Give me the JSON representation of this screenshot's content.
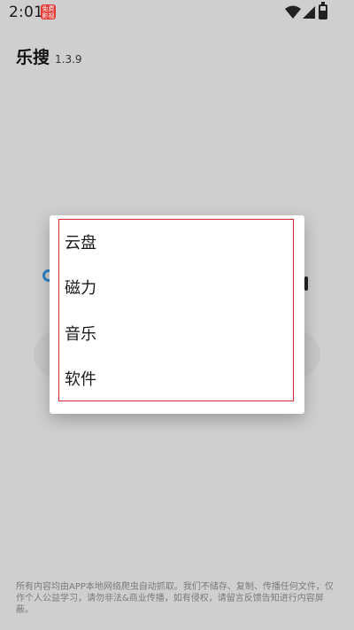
{
  "status_bar": {
    "time": "2:01",
    "app_icon_text": "免费\n影视"
  },
  "header": {
    "title": "乐搜",
    "version": "1.3.9"
  },
  "dialog": {
    "items": [
      {
        "label": "云盘"
      },
      {
        "label": "磁力"
      },
      {
        "label": "音乐"
      },
      {
        "label": "软件"
      }
    ]
  },
  "footer": {
    "disclaimer": "所有内容均由APP本地网络爬虫自动抓取。我们不储存、复制、传播任何文件，仅作个人公益学习，请勿非法&商业传播，如有侵权，请留言反馈告知进行内容屏蔽。"
  },
  "colors": {
    "overlay": "#cfcfcf",
    "dialog_bg": "#ffffff",
    "highlight_border": "#d9232d",
    "accent_blue": "#2f80c5"
  }
}
